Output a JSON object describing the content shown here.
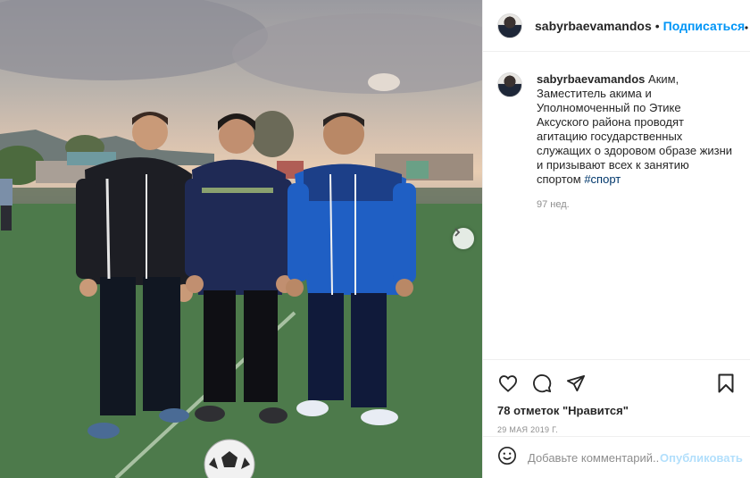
{
  "post": {
    "username": "sabyrbaevamandos",
    "separator": "•",
    "follow_label": "Подписаться",
    "caption": "Аким, Заместитель акима и Уполномоченный по Этике Аксуского района проводят агитацию государственных служащих о здоровом образе жизни и призывают всех к занятию спортом",
    "hashtag": "#спорт",
    "caption_time": "97 нед.",
    "likes_label": "78 отметок \"Нравится\"",
    "date": "29 мая 2019 г."
  },
  "comment_box": {
    "placeholder": "Добавьте комментарий...",
    "post_label": "Опубликовать"
  },
  "icons": {
    "like": "heart-icon",
    "comment": "comment-bubble-icon",
    "share": "paper-plane-icon",
    "save": "bookmark-icon",
    "more": "ellipsis-icon",
    "emoji": "smiley-icon",
    "next": "chevron-right-icon"
  },
  "colors": {
    "accent": "#0095f6",
    "hashtag": "#00376b",
    "post_disabled": "#b2dffc",
    "muted": "#8e8e8e"
  }
}
